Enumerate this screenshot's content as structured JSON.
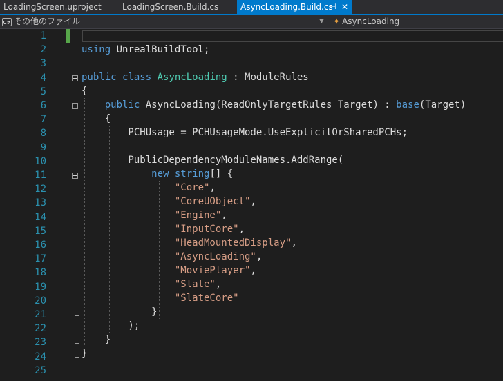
{
  "tabs": [
    {
      "label": "LoadingScreen.uproject",
      "active": false
    },
    {
      "label": "LoadingScreen.Build.cs",
      "active": false
    },
    {
      "label": "AsyncLoading.Build.cs",
      "active": true
    }
  ],
  "tab_controls": {
    "pin_icon": "pin-icon",
    "close_icon": "close-icon"
  },
  "navbar": {
    "project_icon": "C#",
    "project_label": "その他のファイル",
    "member_label": "AsyncLoading"
  },
  "line_numbers": [
    "1",
    "2",
    "3",
    "4",
    "5",
    "6",
    "7",
    "8",
    "9",
    "10",
    "11",
    "12",
    "13",
    "14",
    "15",
    "16",
    "17",
    "18",
    "19",
    "20",
    "21",
    "22",
    "23",
    "24",
    "25"
  ],
  "code": {
    "l2_kw": "using",
    "l2_rest": " UnrealBuildTool;",
    "l4_kw1": "public",
    "l4_kw2": " class",
    "l4_type": " AsyncLoading",
    "l4_rest": " : ModuleRules",
    "l5": "{",
    "l6_indent": "    ",
    "l6_kw": "public",
    "l6_rest": " AsyncLoading(ReadOnlyTargetRules Target) : ",
    "l6_kw2": "base",
    "l6_tail": "(Target)",
    "l7": "    {",
    "l8": "        PCHUsage = PCHUsageMode.UseExplicitOrSharedPCHs;",
    "l10": "        PublicDependencyModuleNames.AddRange(",
    "l11_indent": "            ",
    "l11_kw": "new",
    "l11_kw2": " string",
    "l11_rest": "[] {",
    "strings": [
      "\"Core\"",
      "\"CoreUObject\"",
      "\"Engine\"",
      "\"InputCore\"",
      "\"HeadMountedDisplay\"",
      "\"AsyncLoading\"",
      "\"MoviePlayer\"",
      "\"Slate\"",
      "\"SlateCore\""
    ],
    "commas": [
      ",",
      ",",
      ",",
      ",",
      ",",
      ",",
      ",",
      ",",
      ""
    ],
    "l21": "            }",
    "l22": "        );",
    "l23": "    }",
    "l24": "}"
  },
  "colors": {
    "keyword": "#569cd6",
    "type": "#4ec9b0",
    "string": "#d69d85",
    "line_number": "#2b91af",
    "accent": "#007acc"
  }
}
